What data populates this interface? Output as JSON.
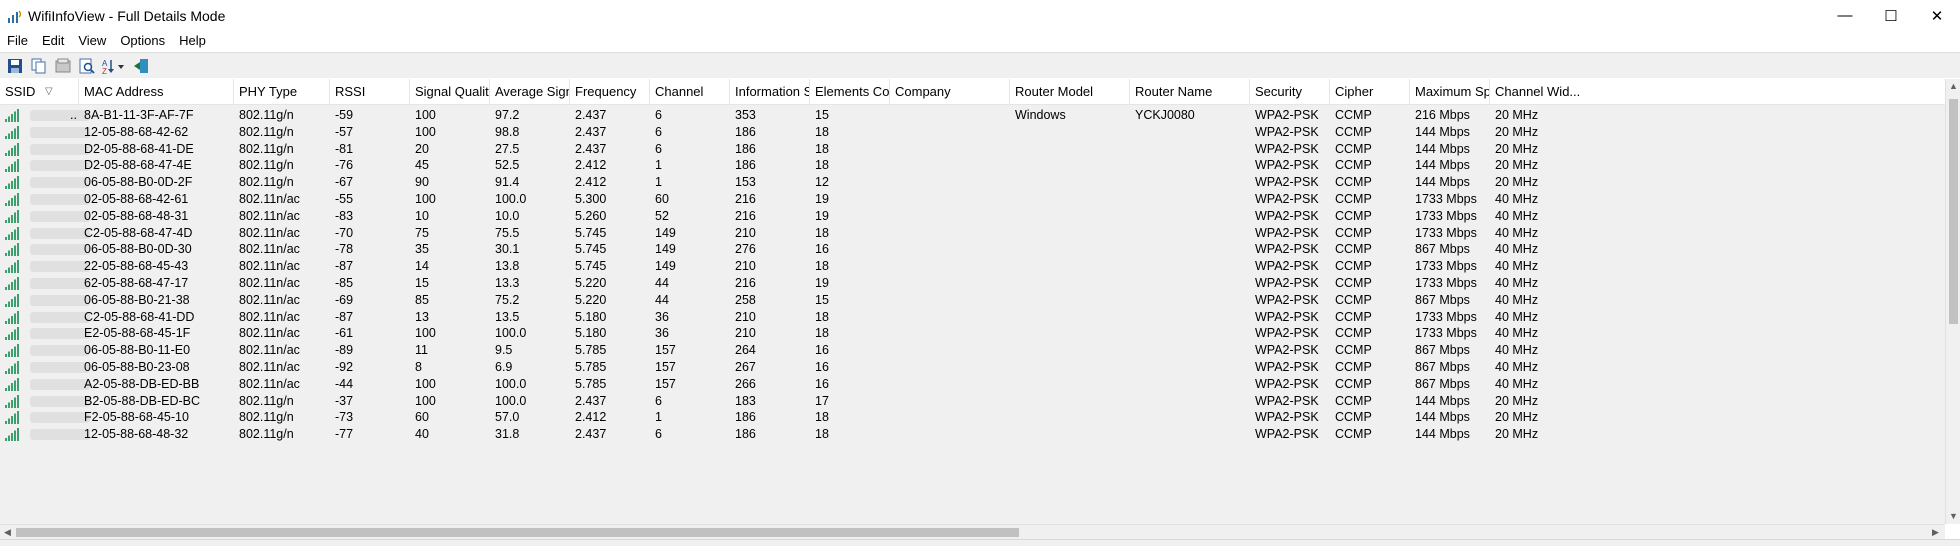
{
  "window": {
    "title": "WifiInfoView  -  Full Details Mode",
    "minimize_glyph": "—",
    "maximize_glyph": "☐",
    "close_glyph": "✕"
  },
  "menu": [
    "File",
    "Edit",
    "View",
    "Options",
    "Help"
  ],
  "toolbar": [
    "save-icon",
    "copy-icon",
    "properties-icon",
    "find-icon",
    "sort-icon",
    "exit-icon"
  ],
  "columns": [
    "SSID",
    "MAC Address",
    "PHY Type",
    "RSSI",
    "Signal Quality",
    "Average Sign...",
    "Frequency",
    "Channel",
    "Information S...",
    "Elements Cou...",
    "Company",
    "Router Model",
    "Router Name",
    "Security",
    "Cipher",
    "Maximum Sp...",
    "Channel Wid..."
  ],
  "sort_glyph": "▽",
  "rows": [
    {
      "ssid": "..",
      "mac": "8A-B1-11-3F-AF-7F",
      "phy": "802.11g/n",
      "rssi": "-59",
      "quality": "100",
      "avg": "97.2",
      "freq": "2.437",
      "channel": "6",
      "info": "353",
      "elements": "15",
      "company": "",
      "model": "Windows",
      "name": "YCKJ0080",
      "security": "WPA2-PSK",
      "cipher": "CCMP",
      "maxspeed": "216 Mbps",
      "width": "20 MHz"
    },
    {
      "ssid": "",
      "mac": "12-05-88-68-42-62",
      "phy": "802.11g/n",
      "rssi": "-57",
      "quality": "100",
      "avg": "98.8",
      "freq": "2.437",
      "channel": "6",
      "info": "186",
      "elements": "18",
      "company": "",
      "model": "",
      "name": "",
      "security": "WPA2-PSK",
      "cipher": "CCMP",
      "maxspeed": "144 Mbps",
      "width": "20 MHz"
    },
    {
      "ssid": "",
      "mac": "D2-05-88-68-41-DE",
      "phy": "802.11g/n",
      "rssi": "-81",
      "quality": "20",
      "avg": "27.5",
      "freq": "2.437",
      "channel": "6",
      "info": "186",
      "elements": "18",
      "company": "",
      "model": "",
      "name": "",
      "security": "WPA2-PSK",
      "cipher": "CCMP",
      "maxspeed": "144 Mbps",
      "width": "20 MHz"
    },
    {
      "ssid": "",
      "mac": "D2-05-88-68-47-4E",
      "phy": "802.11g/n",
      "rssi": "-76",
      "quality": "45",
      "avg": "52.5",
      "freq": "2.412",
      "channel": "1",
      "info": "186",
      "elements": "18",
      "company": "",
      "model": "",
      "name": "",
      "security": "WPA2-PSK",
      "cipher": "CCMP",
      "maxspeed": "144 Mbps",
      "width": "20 MHz"
    },
    {
      "ssid": "",
      "mac": "06-05-88-B0-0D-2F",
      "phy": "802.11g/n",
      "rssi": "-67",
      "quality": "90",
      "avg": "91.4",
      "freq": "2.412",
      "channel": "1",
      "info": "153",
      "elements": "12",
      "company": "",
      "model": "",
      "name": "",
      "security": "WPA2-PSK",
      "cipher": "CCMP",
      "maxspeed": "144 Mbps",
      "width": "20 MHz"
    },
    {
      "ssid": "",
      "mac": "02-05-88-68-42-61",
      "phy": "802.11n/ac",
      "rssi": "-55",
      "quality": "100",
      "avg": "100.0",
      "freq": "5.300",
      "channel": "60",
      "info": "216",
      "elements": "19",
      "company": "",
      "model": "",
      "name": "",
      "security": "WPA2-PSK",
      "cipher": "CCMP",
      "maxspeed": "1733 Mbps",
      "width": "40 MHz"
    },
    {
      "ssid": "",
      "mac": "02-05-88-68-48-31",
      "phy": "802.11n/ac",
      "rssi": "-83",
      "quality": "10",
      "avg": "10.0",
      "freq": "5.260",
      "channel": "52",
      "info": "216",
      "elements": "19",
      "company": "",
      "model": "",
      "name": "",
      "security": "WPA2-PSK",
      "cipher": "CCMP",
      "maxspeed": "1733 Mbps",
      "width": "40 MHz"
    },
    {
      "ssid": "",
      "mac": "C2-05-88-68-47-4D",
      "phy": "802.11n/ac",
      "rssi": "-70",
      "quality": "75",
      "avg": "75.5",
      "freq": "5.745",
      "channel": "149",
      "info": "210",
      "elements": "18",
      "company": "",
      "model": "",
      "name": "",
      "security": "WPA2-PSK",
      "cipher": "CCMP",
      "maxspeed": "1733 Mbps",
      "width": "40 MHz"
    },
    {
      "ssid": "",
      "mac": "06-05-88-B0-0D-30",
      "phy": "802.11n/ac",
      "rssi": "-78",
      "quality": "35",
      "avg": "30.1",
      "freq": "5.745",
      "channel": "149",
      "info": "276",
      "elements": "16",
      "company": "",
      "model": "",
      "name": "",
      "security": "WPA2-PSK",
      "cipher": "CCMP",
      "maxspeed": "867 Mbps",
      "width": "40 MHz"
    },
    {
      "ssid": "",
      "mac": "22-05-88-68-45-43",
      "phy": "802.11n/ac",
      "rssi": "-87",
      "quality": "14",
      "avg": "13.8",
      "freq": "5.745",
      "channel": "149",
      "info": "210",
      "elements": "18",
      "company": "",
      "model": "",
      "name": "",
      "security": "WPA2-PSK",
      "cipher": "CCMP",
      "maxspeed": "1733 Mbps",
      "width": "40 MHz"
    },
    {
      "ssid": "",
      "mac": "62-05-88-68-47-17",
      "phy": "802.11n/ac",
      "rssi": "-85",
      "quality": "15",
      "avg": "13.3",
      "freq": "5.220",
      "channel": "44",
      "info": "216",
      "elements": "19",
      "company": "",
      "model": "",
      "name": "",
      "security": "WPA2-PSK",
      "cipher": "CCMP",
      "maxspeed": "1733 Mbps",
      "width": "40 MHz"
    },
    {
      "ssid": "",
      "mac": "06-05-88-B0-21-38",
      "phy": "802.11n/ac",
      "rssi": "-69",
      "quality": "85",
      "avg": "75.2",
      "freq": "5.220",
      "channel": "44",
      "info": "258",
      "elements": "15",
      "company": "",
      "model": "",
      "name": "",
      "security": "WPA2-PSK",
      "cipher": "CCMP",
      "maxspeed": "867 Mbps",
      "width": "40 MHz"
    },
    {
      "ssid": "",
      "mac": "C2-05-88-68-41-DD",
      "phy": "802.11n/ac",
      "rssi": "-87",
      "quality": "13",
      "avg": "13.5",
      "freq": "5.180",
      "channel": "36",
      "info": "210",
      "elements": "18",
      "company": "",
      "model": "",
      "name": "",
      "security": "WPA2-PSK",
      "cipher": "CCMP",
      "maxspeed": "1733 Mbps",
      "width": "40 MHz"
    },
    {
      "ssid": "",
      "mac": "E2-05-88-68-45-1F",
      "phy": "802.11n/ac",
      "rssi": "-61",
      "quality": "100",
      "avg": "100.0",
      "freq": "5.180",
      "channel": "36",
      "info": "210",
      "elements": "18",
      "company": "",
      "model": "",
      "name": "",
      "security": "WPA2-PSK",
      "cipher": "CCMP",
      "maxspeed": "1733 Mbps",
      "width": "40 MHz"
    },
    {
      "ssid": "",
      "mac": "06-05-88-B0-11-E0",
      "phy": "802.11n/ac",
      "rssi": "-89",
      "quality": "11",
      "avg": "9.5",
      "freq": "5.785",
      "channel": "157",
      "info": "264",
      "elements": "16",
      "company": "",
      "model": "",
      "name": "",
      "security": "WPA2-PSK",
      "cipher": "CCMP",
      "maxspeed": "867 Mbps",
      "width": "40 MHz"
    },
    {
      "ssid": "",
      "mac": "06-05-88-B0-23-08",
      "phy": "802.11n/ac",
      "rssi": "-92",
      "quality": "8",
      "avg": "6.9",
      "freq": "5.785",
      "channel": "157",
      "info": "267",
      "elements": "16",
      "company": "",
      "model": "",
      "name": "",
      "security": "WPA2-PSK",
      "cipher": "CCMP",
      "maxspeed": "867 Mbps",
      "width": "40 MHz"
    },
    {
      "ssid": "",
      "mac": "A2-05-88-DB-ED-BB",
      "phy": "802.11n/ac",
      "rssi": "-44",
      "quality": "100",
      "avg": "100.0",
      "freq": "5.785",
      "channel": "157",
      "info": "266",
      "elements": "16",
      "company": "",
      "model": "",
      "name": "",
      "security": "WPA2-PSK",
      "cipher": "CCMP",
      "maxspeed": "867 Mbps",
      "width": "40 MHz"
    },
    {
      "ssid": "",
      "mac": "B2-05-88-DB-ED-BC",
      "phy": "802.11g/n",
      "rssi": "-37",
      "quality": "100",
      "avg": "100.0",
      "freq": "2.437",
      "channel": "6",
      "info": "183",
      "elements": "17",
      "company": "",
      "model": "",
      "name": "",
      "security": "WPA2-PSK",
      "cipher": "CCMP",
      "maxspeed": "144 Mbps",
      "width": "20 MHz"
    },
    {
      "ssid": "",
      "mac": "F2-05-88-68-45-10",
      "phy": "802.11g/n",
      "rssi": "-73",
      "quality": "60",
      "avg": "57.0",
      "freq": "2.412",
      "channel": "1",
      "info": "186",
      "elements": "18",
      "company": "",
      "model": "",
      "name": "",
      "security": "WPA2-PSK",
      "cipher": "CCMP",
      "maxspeed": "144 Mbps",
      "width": "20 MHz"
    },
    {
      "ssid": "",
      "mac": "12-05-88-68-48-32",
      "phy": "802.11g/n",
      "rssi": "-77",
      "quality": "40",
      "avg": "31.8",
      "freq": "2.437",
      "channel": "6",
      "info": "186",
      "elements": "18",
      "company": "",
      "model": "",
      "name": "",
      "security": "WPA2-PSK",
      "cipher": "CCMP",
      "maxspeed": "144 Mbps",
      "width": "20 MHz"
    }
  ],
  "colors": {
    "signal": "#3ca06e",
    "signal_faint": "#9fd3b8",
    "header_border": "#e5e5e5",
    "row_bg": "#f0f0f0"
  }
}
